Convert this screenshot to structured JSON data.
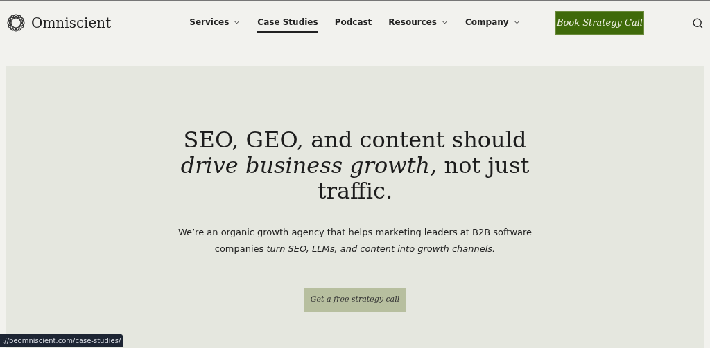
{
  "header": {
    "brand": "Omniscient",
    "nav": [
      {
        "label": "Services",
        "dropdown": true,
        "selected": false
      },
      {
        "label": "Case Studies",
        "dropdown": false,
        "selected": true
      },
      {
        "label": "Podcast",
        "dropdown": false,
        "selected": false
      },
      {
        "label": "Resources",
        "dropdown": true,
        "selected": false
      },
      {
        "label": "Company",
        "dropdown": true,
        "selected": false
      }
    ],
    "cta": "Book Strategy Call"
  },
  "hero": {
    "heading": "SEO, GEO, and content should *drive business growth*, not just traffic.",
    "subtitle": "We’re an organic growth agency that helps marketing leaders at B2B software companies *turn SEO, LLMs, and content into growth channels.*",
    "button": "Get a free strategy call"
  },
  "status_bar": {
    "url": "://beomniscient.com/case-studies/"
  }
}
